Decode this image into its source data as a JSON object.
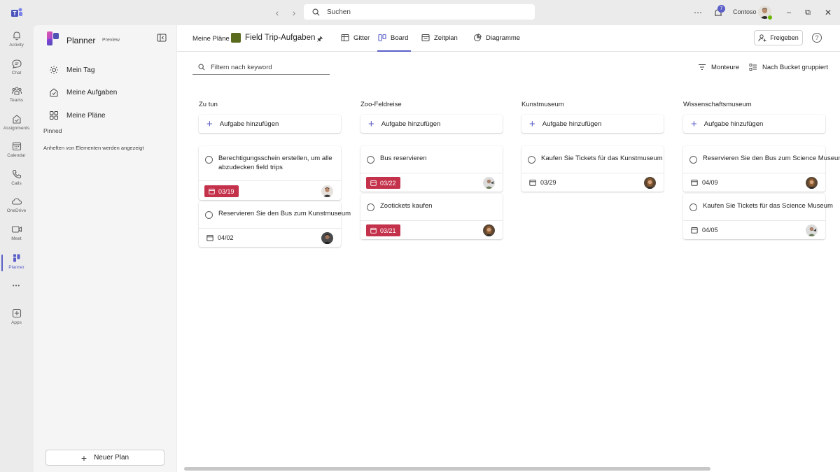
{
  "titlebar": {
    "search_label": "Suchen",
    "notification_count": "7",
    "org_name": "Contoso",
    "more_label": "⋯"
  },
  "rail": {
    "items": [
      {
        "label": "Activity",
        "icon": "bell-icon"
      },
      {
        "label": "Chat",
        "icon": "chat-icon"
      },
      {
        "label": "Teams",
        "icon": "teams-icon"
      },
      {
        "label": "Assignments",
        "icon": "assignments-icon"
      },
      {
        "label": "Calendar",
        "icon": "calendar-icon"
      },
      {
        "label": "Calls",
        "icon": "phone-icon"
      },
      {
        "label": "OneDrive",
        "icon": "cloud-icon"
      },
      {
        "label": "Meet",
        "icon": "video-icon"
      },
      {
        "label": "Planner",
        "icon": "planner-icon",
        "active": true
      },
      {
        "label": "Apps",
        "icon": "add-apps-icon"
      }
    ],
    "more_label": "•••"
  },
  "left_panel": {
    "title": "Planner",
    "badge": "Preview",
    "nav": [
      "Mein Tag",
      "Meine Aufgaben",
      "Meine Pläne"
    ],
    "pinned_label": "Pinned",
    "pinned_hint": "Anheften von Elementen werden angezeigt",
    "new_plan_label": "Neuer Plan"
  },
  "header": {
    "breadcrumb_root": "Meine Pläne",
    "breadcrumb_sep": ">",
    "plan_name": "Field Trip-Aufgaben",
    "tabs": [
      "Gitter",
      "Board",
      "Zeitplan",
      "Diagramme"
    ],
    "active_tab": "Board",
    "share_label": "Freigeben",
    "help_label": "?"
  },
  "toolbar": {
    "filter_placeholder": "Filtern nach keyword",
    "filter_label": "Monteure",
    "group_label": "Nach Bucket gruppiert"
  },
  "board": {
    "add_task_label": "Aufgabe hinzufügen",
    "buckets": [
      {
        "title": "Zu tun",
        "tasks": [
          {
            "title": "Berechtigungsschein erstellen, um alle abzudecken field trips",
            "date": "03/19",
            "overdue": true
          },
          {
            "title": "Reservieren Sie den Bus zum Kunstmuseum",
            "date": "04/02",
            "overdue": false
          }
        ]
      },
      {
        "title": "Zoo-Feldreise",
        "tasks": [
          {
            "title": "Bus reservieren",
            "date": "03/22",
            "overdue": true
          },
          {
            "title": "Zootickets kaufen",
            "date": "03/21",
            "overdue": true
          }
        ]
      },
      {
        "title": "Kunstmuseum",
        "tasks": [
          {
            "title": "Kaufen Sie Tickets für das Kunstmuseum",
            "date": "03/29",
            "overdue": false
          }
        ]
      },
      {
        "title": "Wissenschaftsmuseum",
        "tasks": [
          {
            "title": "Reservieren Sie den Bus zum Science Museum",
            "date": "04/09",
            "overdue": false
          },
          {
            "title": "Kaufen Sie Tickets für das Science Museum",
            "date": "04/05",
            "overdue": false
          }
        ]
      }
    ]
  },
  "colors": {
    "accent": "#5b5fc7",
    "overdue": "#c4314b",
    "presence": "#6bb700"
  }
}
